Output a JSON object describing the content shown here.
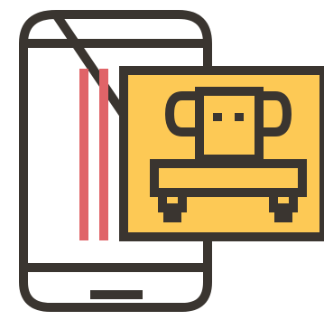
{
  "icon": {
    "name": "mobile-robot-control-icon",
    "parts": {
      "phone": "smartphone-icon",
      "speaker": "speaker-slot-icon",
      "home_button": "home-button-icon",
      "stripes": "accent-stripes-icon",
      "card": "robot-card-icon",
      "robot": "robot-icon"
    }
  },
  "colors": {
    "outline": "#3a3530",
    "accent_red": "#e06468",
    "card_fill": "#fdc955",
    "background": "#ffffff"
  }
}
